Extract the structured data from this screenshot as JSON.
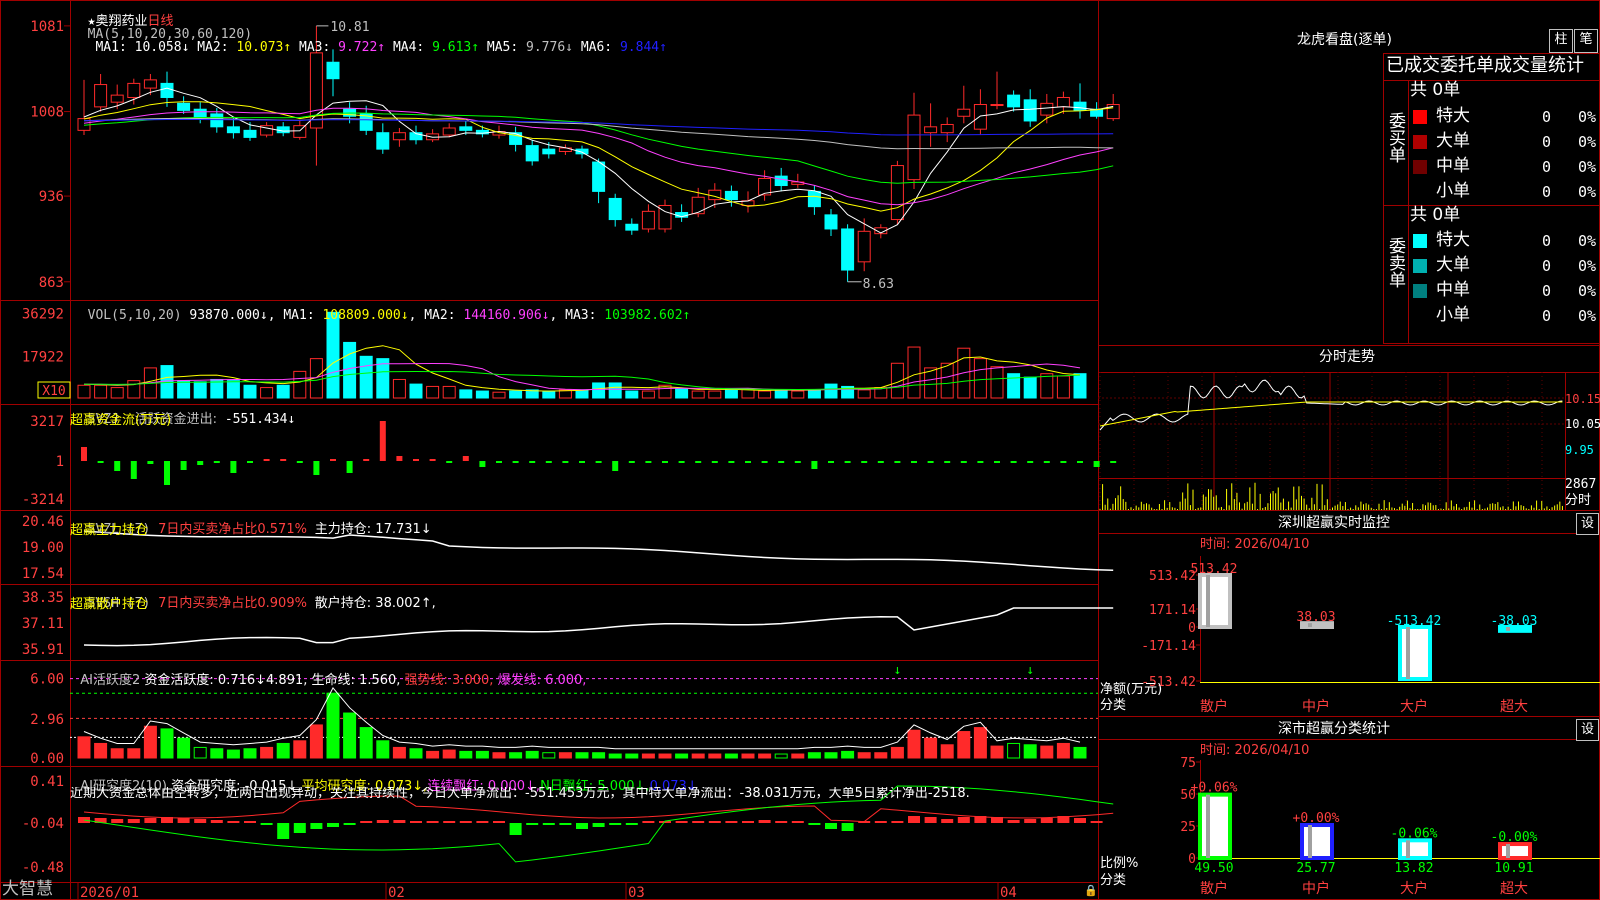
{
  "colors": {
    "up": "#ff2a2a",
    "down": "#00ffff",
    "ma1": "#ffffff",
    "ma2": "#ffff00",
    "ma3": "#ff40ff",
    "ma4": "#00ff00",
    "ma5": "#c0c0c0",
    "ma6": "#2020ff",
    "grid": "#a00000",
    "label": "#ff4040"
  },
  "kline": {
    "stock_name": "奥翔药业",
    "period": "日线",
    "ma_label": "MA(5,10,20,30,60,120)",
    "ma_values": [
      {
        "name": "MA1:",
        "value": "10.058↓",
        "color": "#ffffff"
      },
      {
        "name": "MA2:",
        "value": "10.073↑",
        "color": "#ffff00"
      },
      {
        "name": "MA3:",
        "value": "9.722↑",
        "color": "#ff40ff"
      },
      {
        "name": "MA4:",
        "value": "9.613↑",
        "color": "#00ff00"
      },
      {
        "name": "MA5:",
        "value": "9.776↓",
        "color": "#c0c0c0"
      },
      {
        "name": "MA6:",
        "value": "9.844↑",
        "color": "#2020ff"
      }
    ],
    "y_ticks": [
      "1081",
      "1008",
      "936",
      "863"
    ],
    "high_marker": "10.81",
    "low_marker": "8.63",
    "candles": [
      {
        "o": 9.92,
        "c": 10.02,
        "h": 10.35,
        "l": 9.88
      },
      {
        "o": 10.12,
        "c": 10.31,
        "h": 10.4,
        "l": 10.08
      },
      {
        "o": 10.16,
        "c": 10.22,
        "h": 10.31,
        "l": 10.1
      },
      {
        "o": 10.2,
        "c": 10.32,
        "h": 10.36,
        "l": 10.14
      },
      {
        "o": 10.28,
        "c": 10.35,
        "h": 10.4,
        "l": 10.22
      },
      {
        "o": 10.32,
        "c": 10.2,
        "h": 10.42,
        "l": 10.12
      },
      {
        "o": 10.15,
        "c": 10.09,
        "h": 10.21,
        "l": 10.06
      },
      {
        "o": 10.1,
        "c": 10.03,
        "h": 10.16,
        "l": 9.98
      },
      {
        "o": 10.06,
        "c": 9.95,
        "h": 10.11,
        "l": 9.9
      },
      {
        "o": 9.95,
        "c": 9.9,
        "h": 10.03,
        "l": 9.85
      },
      {
        "o": 9.92,
        "c": 9.86,
        "h": 9.99,
        "l": 9.83
      },
      {
        "o": 9.88,
        "c": 9.96,
        "h": 9.99,
        "l": 9.86
      },
      {
        "o": 9.95,
        "c": 9.9,
        "h": 9.99,
        "l": 9.87
      },
      {
        "o": 9.86,
        "c": 9.96,
        "h": 10.01,
        "l": 9.84
      },
      {
        "o": 9.94,
        "c": 10.58,
        "h": 10.81,
        "l": 9.62
      },
      {
        "o": 10.5,
        "c": 10.36,
        "h": 10.61,
        "l": 10.21
      },
      {
        "o": 10.1,
        "c": 10.04,
        "h": 10.16,
        "l": 9.98
      },
      {
        "o": 10.06,
        "c": 9.92,
        "h": 10.13,
        "l": 9.88
      },
      {
        "o": 9.9,
        "c": 9.76,
        "h": 9.98,
        "l": 9.72
      },
      {
        "o": 9.84,
        "c": 9.9,
        "h": 9.94,
        "l": 9.78
      },
      {
        "o": 9.9,
        "c": 9.84,
        "h": 9.96,
        "l": 9.8
      },
      {
        "o": 9.84,
        "c": 9.89,
        "h": 9.93,
        "l": 9.82
      },
      {
        "o": 9.88,
        "c": 9.94,
        "h": 9.98,
        "l": 9.86
      },
      {
        "o": 9.95,
        "c": 9.92,
        "h": 10.0,
        "l": 9.88
      },
      {
        "o": 9.92,
        "c": 9.89,
        "h": 9.96,
        "l": 9.86
      },
      {
        "o": 9.88,
        "c": 9.91,
        "h": 9.96,
        "l": 9.85
      },
      {
        "o": 9.9,
        "c": 9.8,
        "h": 9.95,
        "l": 9.74
      },
      {
        "o": 9.79,
        "c": 9.66,
        "h": 9.84,
        "l": 9.62
      },
      {
        "o": 9.76,
        "c": 9.72,
        "h": 9.82,
        "l": 9.68
      },
      {
        "o": 9.74,
        "c": 9.77,
        "h": 9.8,
        "l": 9.71
      },
      {
        "o": 9.76,
        "c": 9.72,
        "h": 9.79,
        "l": 9.68
      },
      {
        "o": 9.65,
        "c": 9.4,
        "h": 9.68,
        "l": 9.3
      },
      {
        "o": 9.34,
        "c": 9.16,
        "h": 9.38,
        "l": 9.1
      },
      {
        "o": 9.12,
        "c": 9.07,
        "h": 9.17,
        "l": 9.03
      },
      {
        "o": 9.08,
        "c": 9.23,
        "h": 9.29,
        "l": 9.05
      },
      {
        "o": 9.08,
        "c": 9.28,
        "h": 9.33,
        "l": 9.05
      },
      {
        "o": 9.22,
        "c": 9.18,
        "h": 9.29,
        "l": 9.14
      },
      {
        "o": 9.21,
        "c": 9.35,
        "h": 9.43,
        "l": 9.18
      },
      {
        "o": 9.33,
        "c": 9.41,
        "h": 9.47,
        "l": 9.26
      },
      {
        "o": 9.4,
        "c": 9.33,
        "h": 9.45,
        "l": 9.27
      },
      {
        "o": 9.28,
        "c": 9.32,
        "h": 9.4,
        "l": 9.22
      },
      {
        "o": 9.37,
        "c": 9.51,
        "h": 9.58,
        "l": 9.32
      },
      {
        "o": 9.53,
        "c": 9.45,
        "h": 9.6,
        "l": 9.4
      },
      {
        "o": 9.46,
        "c": 9.48,
        "h": 9.55,
        "l": 9.43
      },
      {
        "o": 9.4,
        "c": 9.27,
        "h": 9.45,
        "l": 9.2
      },
      {
        "o": 9.2,
        "c": 9.08,
        "h": 9.25,
        "l": 9.02
      },
      {
        "o": 9.08,
        "c": 8.73,
        "h": 9.12,
        "l": 8.63
      },
      {
        "o": 8.8,
        "c": 9.06,
        "h": 9.17,
        "l": 8.72
      },
      {
        "o": 9.04,
        "c": 9.09,
        "h": 9.12,
        "l": 9.0
      },
      {
        "o": 9.16,
        "c": 9.62,
        "h": 9.66,
        "l": 9.12
      },
      {
        "o": 9.5,
        "c": 10.05,
        "h": 10.24,
        "l": 9.42
      },
      {
        "o": 9.9,
        "c": 9.95,
        "h": 10.15,
        "l": 9.78
      },
      {
        "o": 9.9,
        "c": 9.97,
        "h": 10.03,
        "l": 9.82
      },
      {
        "o": 10.04,
        "c": 10.1,
        "h": 10.3,
        "l": 9.98
      },
      {
        "o": 9.93,
        "c": 10.14,
        "h": 10.27,
        "l": 9.88
      },
      {
        "o": 10.14,
        "c": 10.14,
        "h": 10.42,
        "l": 10.1
      },
      {
        "o": 10.22,
        "c": 10.12,
        "h": 10.26,
        "l": 10.08
      },
      {
        "o": 10.18,
        "c": 10.0,
        "h": 10.27,
        "l": 9.95
      },
      {
        "o": 10.05,
        "c": 10.15,
        "h": 10.23,
        "l": 9.98
      },
      {
        "o": 10.12,
        "c": 10.2,
        "h": 10.25,
        "l": 10.06
      },
      {
        "o": 10.16,
        "c": 10.09,
        "h": 10.32,
        "l": 10.02
      },
      {
        "o": 10.1,
        "c": 10.04,
        "h": 10.16,
        "l": 10.02
      },
      {
        "o": 10.02,
        "c": 10.14,
        "h": 10.23,
        "l": 10.0
      }
    ]
  },
  "volume": {
    "label": "VOL(5,10,20)",
    "value": "93870.000↓",
    "ma_values": [
      {
        "name": "MA1:",
        "value": "108809.000↓",
        "color": "#ffff00"
      },
      {
        "name": "MA2:",
        "value": "144160.906↓",
        "color": "#ff40ff"
      },
      {
        "name": "MA3:",
        "value": "103982.602↑",
        "color": "#00ff00"
      }
    ],
    "y_ticks": [
      "36292",
      "17922"
    ],
    "unit": "X10",
    "bars": [
      1.1,
      1.1,
      0.9,
      1.5,
      2.6,
      2.8,
      1.5,
      1.4,
      1.6,
      1.5,
      1.1,
      0.9,
      1.1,
      2.3,
      3.4,
      7.4,
      4.8,
      3.6,
      3.4,
      1.6,
      1.2,
      1.0,
      1.0,
      0.7,
      0.6,
      0.5,
      0.6,
      0.7,
      0.6,
      0.7,
      0.7,
      1.3,
      1.3,
      0.6,
      0.6,
      1.1,
      0.8,
      0.6,
      0.6,
      0.7,
      0.8,
      0.6,
      0.7,
      0.6,
      0.7,
      1.2,
      1.0,
      0.7,
      0.9,
      3.0,
      4.4,
      2.6,
      3.0,
      4.3,
      3.4,
      2.7,
      2.1,
      1.8,
      2.1,
      1.9,
      2.1
    ]
  },
  "svzj": {
    "label": "SVZJ",
    "desc": "活跃资金进出:",
    "value": "-551.434↓",
    "sub_title": "超赢资金流(万元)",
    "y_ticks": [
      "3217",
      "1",
      "-3214"
    ],
    "bars": [
      1.4,
      -0.2,
      -1.0,
      -1.8,
      -0.3,
      -2.4,
      -0.9,
      -0.4,
      -0.2,
      -1.2,
      -0.2,
      0,
      0,
      -0.1,
      -1.4,
      0,
      -1.2,
      0,
      4.0,
      0.5,
      0,
      0.2,
      -0.2,
      0.5,
      -0.6,
      -0.2,
      -0.2,
      -0.2,
      -0.2,
      -0.2,
      -0.2,
      -0.2,
      -1.0,
      -0.2,
      -0.2,
      -0.2,
      -0.2,
      -0.2,
      -0.2,
      -0.2,
      -0.2,
      -0.2,
      -0.2,
      -0.2,
      -0.8,
      -0.2,
      -0.2,
      -0.2,
      -0.2,
      -0.2,
      -0.2,
      -0.2,
      -0.2,
      -0.2,
      -0.2,
      -0.2,
      -0.2,
      -0.2,
      -0.2,
      -0.2,
      -0.2,
      -0.6,
      -0.2,
      0.2,
      1.0,
      1.8,
      -1.4,
      0.4,
      -1.4,
      -1.0,
      -1.6,
      -1.6,
      -0.3,
      -0.2,
      0.8,
      -0.4
    ],
    "tick_labels_fixed": []
  },
  "svzl": {
    "label": "SVZL (7)",
    "desc": "7日内买卖净占比0.571%",
    "hold": "主力持仓: 17.731↓",
    "sub_title": "超赢主力持仓",
    "y_ticks": [
      "20.46",
      "19.00",
      "17.54"
    ]
  },
  "svsh": {
    "label": "SVSH (7)",
    "desc": "7日内买卖净占比0.909%",
    "hold": "散户持仓: 38.002↑,",
    "sub_title": "超赢散户持仓",
    "y_ticks": [
      "38.35",
      "37.11",
      "35.91"
    ]
  },
  "ai_activity": {
    "label": "AI活跃度2",
    "desc": "资金活跃度: 0.716↓",
    "val2": "4.891,",
    "life": "生命线: 1.560,",
    "strong": "强势线: 3.000,",
    "burst": "爆发线: 6.000,",
    "y_ticks": [
      "6.00",
      "2.96",
      "0.00"
    ]
  },
  "ai_research": {
    "label": "AI研究度2(10)",
    "desc": "资金研究度: -0.015↓,",
    "avg": "平均研究度: 0.073↓,",
    "red": "连续飘红: 0.000↓,",
    "nred": "N日飘红: 5.000↓,",
    "v5": "0.073↓",
    "comment": "近期大资金总体由空转多，近两日出现异动，关注其持续性，今日大单净流出：-551.453万元，其中特大单净流出：-38.031万元，大单5日累计净出-2518.",
    "y_ticks": [
      "0.41",
      "-0.04",
      "-0.48"
    ]
  },
  "x_axis": {
    "dates": [
      "2026/01",
      "02",
      "03",
      "04"
    ]
  },
  "brand": "大智慧",
  "right": {
    "dragon": {
      "title": "龙虎看盘(逐单)",
      "btn_bar": "柱",
      "btn_pen": "笔",
      "header": "已成交委托单成交量统计",
      "buy": {
        "label": "委买单",
        "total": "共 0单",
        "rows": [
          {
            "name": "特大",
            "v": "0",
            "p": "0%",
            "c": "#ff0000"
          },
          {
            "name": "大单",
            "v": "0",
            "p": "0%",
            "c": "#b00000"
          },
          {
            "name": "中单",
            "v": "0",
            "p": "0%",
            "c": "#700000"
          },
          {
            "name": "小单",
            "v": "0",
            "p": "0%",
            "c": "#000000"
          }
        ]
      },
      "sell": {
        "label": "委卖单",
        "total": "共 0单",
        "rows": [
          {
            "name": "特大",
            "v": "0",
            "p": "0%",
            "c": "#00ffff"
          },
          {
            "name": "大单",
            "v": "0",
            "p": "0%",
            "c": "#00b0b0"
          },
          {
            "name": "中单",
            "v": "0",
            "p": "0%",
            "c": "#008080"
          },
          {
            "name": "小单",
            "v": "0",
            "p": "0%",
            "c": "#000000"
          }
        ]
      }
    },
    "intraday": {
      "title": "分时走势",
      "y_ticks": [
        "10.15",
        "10.05",
        "9.95"
      ],
      "vol_tick": "2867",
      "vol_label": "分时"
    },
    "monitor": {
      "title": "深圳超赢实时监控",
      "btn": "设",
      "time": "时间: 2026/04/10",
      "y_ticks": [
        "513.42",
        "171.14",
        "0",
        "-171.14",
        "-513.42"
      ],
      "bars": [
        {
          "cat": "散户",
          "val": "513.42",
          "n": 513.42
        },
        {
          "cat": "中户",
          "val": "38.03",
          "n": 38.03
        },
        {
          "cat": "大户",
          "val": "-513.42",
          "n": -513.42
        },
        {
          "cat": "超大",
          "val": "-38.03",
          "n": -38.03
        }
      ],
      "ylabel": "净额(万元)",
      "xlabel": "分类"
    },
    "classify": {
      "title": "深市超赢分类统计",
      "btn": "设",
      "time": "时间: 2026/04/10",
      "y_ticks": [
        "75",
        "50",
        "25",
        "0"
      ],
      "bars": [
        {
          "cat": "散户",
          "val": "49.50",
          "delta": "+0.06%",
          "n": 49.5
        },
        {
          "cat": "中户",
          "val": "25.77",
          "delta": "+0.00%",
          "n": 25.77
        },
        {
          "cat": "大户",
          "val": "13.82",
          "delta": "-0.06%",
          "n": 13.82
        },
        {
          "cat": "超大",
          "val": "10.91",
          "delta": "-0.00%",
          "n": 10.91
        }
      ],
      "ylabel": "比例%",
      "xlabel": "分类"
    }
  }
}
